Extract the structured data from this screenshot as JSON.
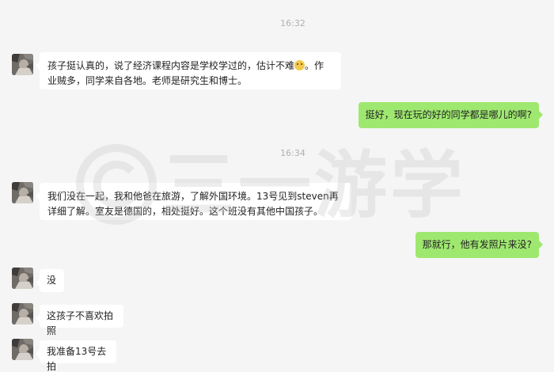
{
  "messages": [
    {
      "type": "time",
      "text": "16:32"
    },
    {
      "type": "received",
      "text_before_emoji": "孩子挺认真的，说了经济课程内容是学校学过的，估计不难",
      "text_after_emoji": "。作业贼多，同学来自各地。老师是研究生和博士。"
    },
    {
      "type": "sent",
      "text": "挺好，现在玩的好的同学都是哪儿的啊?"
    },
    {
      "type": "time",
      "text": "16:34"
    },
    {
      "type": "received",
      "text": "我们没在一起，我和他爸在旅游，了解外国环境。13号见到steven再详细了解。室友是德国的，相处挺好。这个班没有其他中国孩子。"
    },
    {
      "type": "sent",
      "text": "那就行，他有发照片来没?"
    },
    {
      "type": "received",
      "text": "没"
    },
    {
      "type": "received",
      "text": "这孩子不喜欢拍照"
    },
    {
      "type": "received",
      "text": "我准备13号去拍"
    }
  ],
  "emoji": "smiling-face-emoji",
  "watermark": {
    "symbol": "©",
    "text": "三一游学"
  },
  "colors": {
    "background": "#f5f5f5",
    "sent_bubble": "#9fe870",
    "received_bubble": "#ffffff",
    "timestamp": "#b0b0b0"
  }
}
